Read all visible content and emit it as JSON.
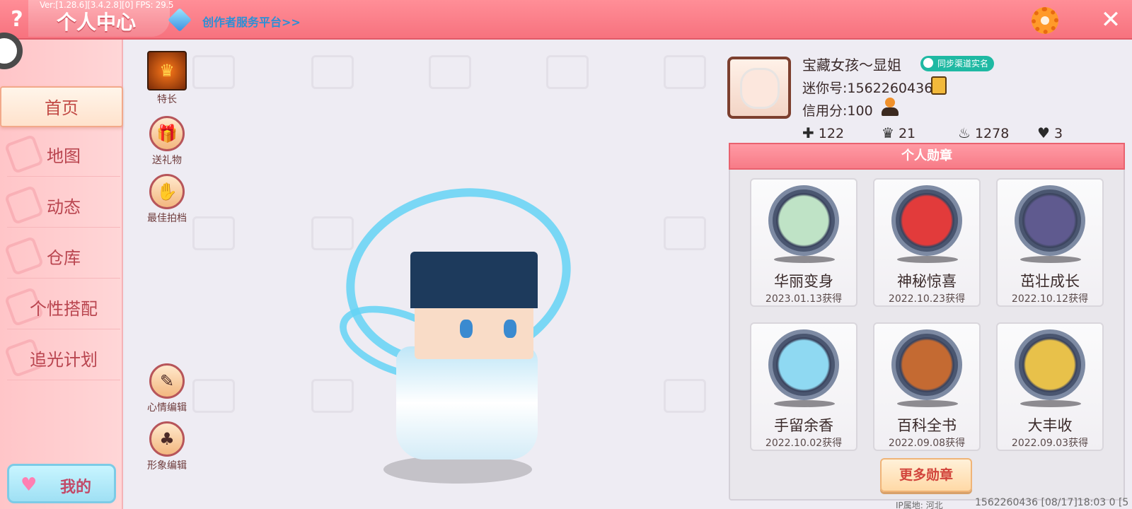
{
  "version_info": "Ver:[1.28.6][3.4.2.8][0] FPS: 29.5",
  "header": {
    "help_label": "?",
    "title": "个人中心",
    "creator_link": "创作者服务平台>>",
    "close_label": "✕"
  },
  "sidebar": {
    "items": [
      {
        "label": "首页"
      },
      {
        "label": "地图"
      },
      {
        "label": "动态"
      },
      {
        "label": "仓库"
      },
      {
        "label": "个性搭配"
      },
      {
        "label": "追光计划"
      }
    ],
    "mine_label": "我的",
    "mine_icon": "heart-icon"
  },
  "actions": {
    "top": [
      {
        "label": "特长",
        "icon": "talent-icon"
      },
      {
        "label": "送礼物",
        "icon": "gift-icon"
      },
      {
        "label": "最佳拍档",
        "icon": "handshake-icon"
      }
    ],
    "bottom": [
      {
        "label": "心情编辑",
        "icon": "edit-icon"
      },
      {
        "label": "形象编辑",
        "icon": "outfit-icon"
      }
    ]
  },
  "profile": {
    "nickname": "宝藏女孩～显姐",
    "sync_badge": "同步渠道实名",
    "mini_id": "迷你号:1562260436",
    "credit": "信用分:100",
    "stats": [
      {
        "icon": "follow-icon",
        "glyph": "✚",
        "value": "122"
      },
      {
        "icon": "fans-icon",
        "glyph": "♛",
        "value": "21"
      },
      {
        "icon": "fire-icon",
        "glyph": "♨",
        "value": "1278"
      },
      {
        "icon": "heart-icon",
        "glyph": "♥",
        "value": "3"
      }
    ]
  },
  "medals": {
    "title": "个人勋章",
    "items": [
      {
        "name": "华丽变身",
        "date": "2023.01.13获得",
        "color": "#bfe3c6"
      },
      {
        "name": "神秘惊喜",
        "date": "2022.10.23获得",
        "color": "#e23b3b"
      },
      {
        "name": "茁壮成长",
        "date": "2022.10.12获得",
        "color": "#5f5a8f"
      },
      {
        "name": "手留余香",
        "date": "2022.10.02获得",
        "color": "#8fd9f2"
      },
      {
        "name": "百科全书",
        "date": "2022.09.08获得",
        "color": "#c46a32"
      },
      {
        "name": "大丰收",
        "date": "2022.09.03获得",
        "color": "#e8c14a"
      }
    ],
    "more_label": "更多勋章"
  },
  "footer": {
    "ip": "IP属地: 河北",
    "info": "1562260436   [08/17]18:03 0  [5"
  }
}
